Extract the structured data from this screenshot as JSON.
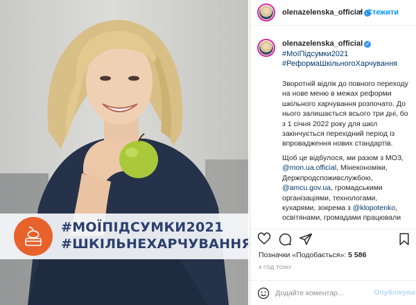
{
  "post": {
    "banner": {
      "line1": "#МОЇПІДСУМКИ2021",
      "line2": "#ШКІЛЬНЕХАРЧУВАННЯ",
      "icon": "apple-lunchbox-icon",
      "badge_color": "#e8622c"
    }
  },
  "header": {
    "username": "olenazelenska_official",
    "separator": "•",
    "follow_label": "Стежити"
  },
  "caption": {
    "username": "olenazelenska_official",
    "hashtags": [
      "#МоїПідсумки2021",
      "#РеформаШкільногоХарчування"
    ],
    "paragraph1": "Зворотній відлік до повного переходу на нове меню в межах реформи шкільного харчування розпочато. До нього залишається всього три дні, бо з 1 січня 2022 року для шкіл закінчується перехідний період із впровадження нових стандартів.",
    "p2_part1": "Щоб це відбулося, ми разом з МОЗ,",
    "p2_mention1": "@mon.ua.official",
    "p2_part2": ", Мінекономіки, Держпродспоживслужбою,",
    "p2_mention2": "@amcu.gov.ua",
    "p2_part3": ", громадськими організаціями, технологами, кухарями, зокрема з",
    "p2_mention3": "@klopotenko",
    "p2_part4": ", освітянами, громадами працювали понад рік."
  },
  "actions": {
    "icons": [
      "heart-icon",
      "comment-icon",
      "share-icon",
      "bookmark-icon"
    ]
  },
  "likes": {
    "label": "Позначки «Подобається»:",
    "count": "5 586"
  },
  "timestamp": "4 ГОД ТОМУ",
  "comment": {
    "placeholder": "Додайте коментар...",
    "publish_label": "Опублікувати"
  },
  "colors": {
    "link": "#00376b",
    "accent": "#0095f6",
    "verified": "#3897f0",
    "banner_text": "#2b3f6e",
    "disabled_publish": "#b3dbff"
  }
}
